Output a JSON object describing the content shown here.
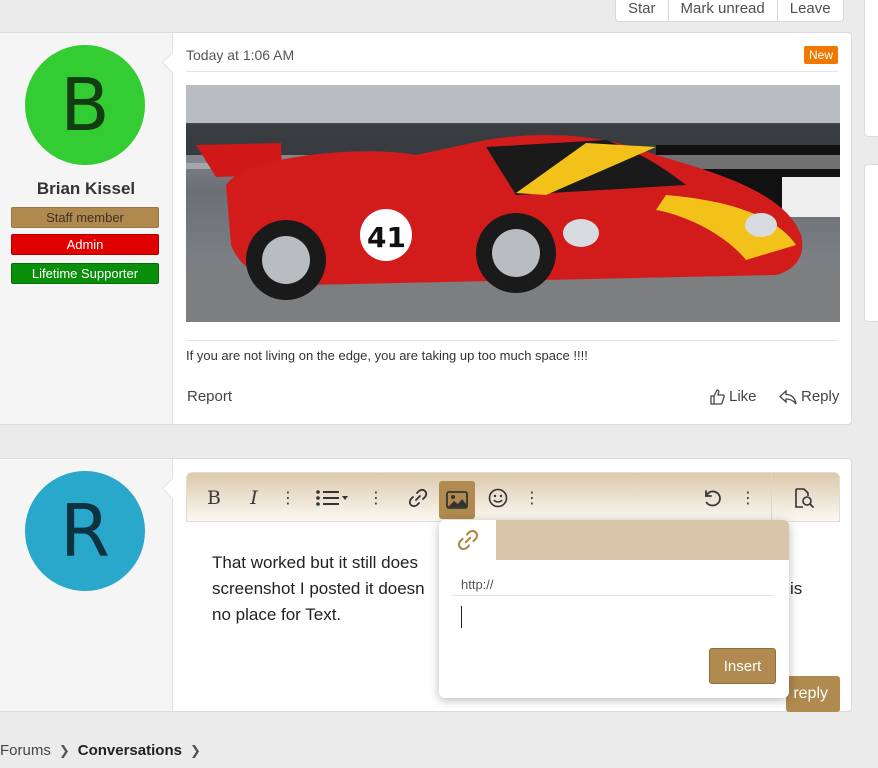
{
  "thread_actions": [
    "Star",
    "Mark unread",
    "Leave"
  ],
  "post": {
    "avatar_letter": "B",
    "username": "Brian Kissel",
    "badges": {
      "staff": "Staff member",
      "admin": "Admin",
      "supporter": "Lifetime Supporter"
    },
    "time": "Today at 1:06 AM",
    "new_label": "New",
    "car_number": "41",
    "signature": "If you are not living on the edge, you are taking up too much space !!!!",
    "report": "Report",
    "like": "Like",
    "reply": "Reply"
  },
  "reply_box": {
    "avatar_letter": "R",
    "text": "That worked but it still does                                        screenshot I posted it doesn                                         is no place for Text.",
    "text_line1": "That worked but it still does",
    "text_line2": "screenshot I posted it doesn",
    "text_line2_end": "is",
    "text_line3": "no place for Text.",
    "post_reply_label": "reply",
    "toolbar": [
      "bold-icon",
      "italic-icon",
      "more-icon",
      "list-icon",
      "more-icon",
      "link-icon",
      "image-icon",
      "emoji-icon",
      "more-icon",
      "undo-icon",
      "more-icon",
      "preview-icon"
    ]
  },
  "image_popup": {
    "url_label": "http://",
    "url_value": "",
    "insert_label": "Insert"
  },
  "breadcrumb": {
    "forums": "Forums",
    "conversations": "Conversations"
  },
  "colors": {
    "accent": "#b08a4e",
    "new": "#f07800",
    "admin": "#e00000",
    "supporter": "#0a8f0a"
  }
}
